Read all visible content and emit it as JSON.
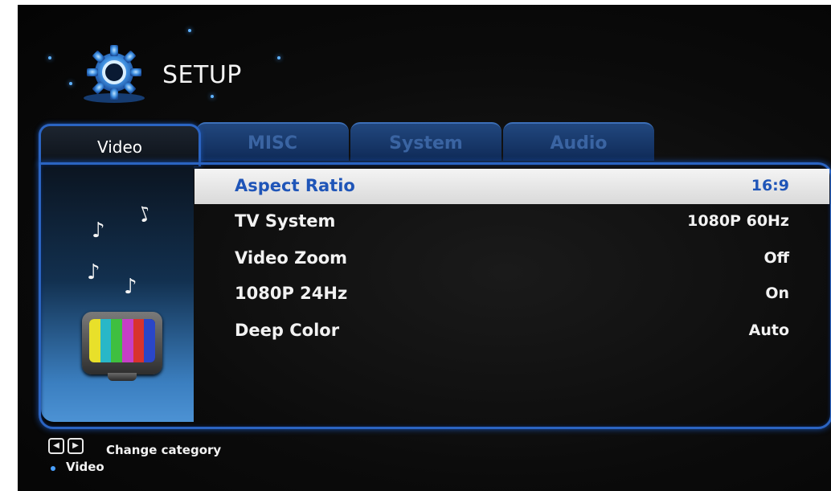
{
  "header": {
    "title": "SETUP",
    "icon": "gear-icon"
  },
  "tabs": [
    {
      "label": "Video",
      "active": true
    },
    {
      "label": "MISC",
      "active": false
    },
    {
      "label": "System",
      "active": false
    },
    {
      "label": "Audio",
      "active": false
    }
  ],
  "menu": [
    {
      "name": "Aspect Ratio",
      "value": "16:9",
      "selected": true
    },
    {
      "name": "TV System",
      "value": "1080P 60Hz",
      "selected": false
    },
    {
      "name": "Video Zoom",
      "value": "Off",
      "selected": false
    },
    {
      "name": "1080P 24Hz",
      "value": "On",
      "selected": false
    },
    {
      "name": "Deep Color",
      "value": "Auto",
      "selected": false
    }
  ],
  "footer": {
    "hint": "Change category",
    "current_category": "Video"
  },
  "colors": {
    "accent": "#2b64c2",
    "selected_text": "#1f55b8",
    "tv_bars": [
      "#e8e02a",
      "#29b7c8",
      "#3fbf3f",
      "#c63fc6",
      "#d8332e",
      "#2a46c8"
    ]
  }
}
